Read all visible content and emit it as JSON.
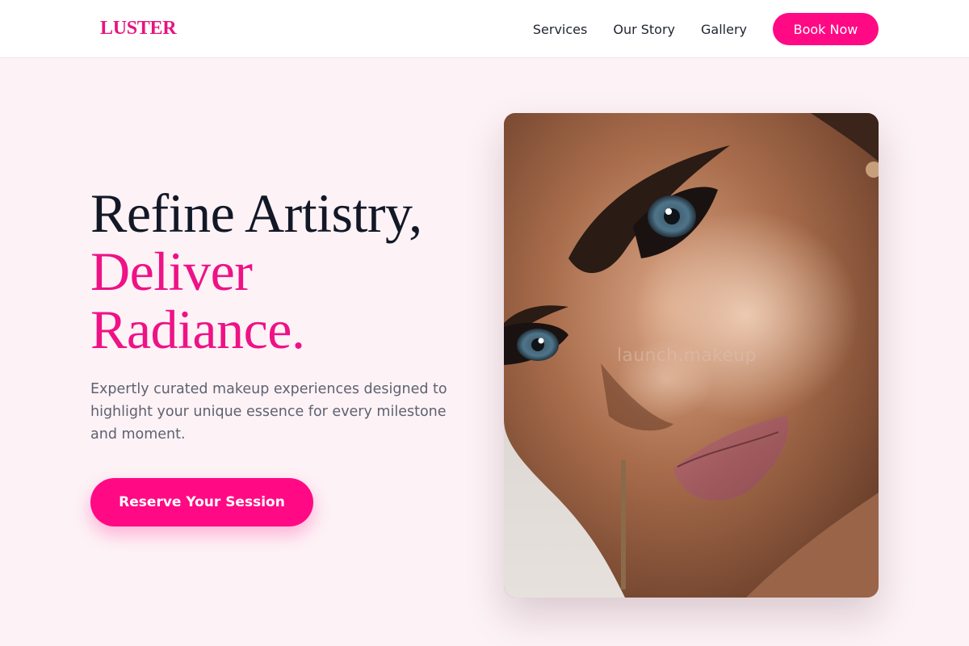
{
  "brand": {
    "logo_text": "LUSTER",
    "accent_color": "#ff0a84"
  },
  "nav": {
    "links": [
      {
        "label": "Services"
      },
      {
        "label": "Our Story"
      },
      {
        "label": "Gallery"
      }
    ],
    "cta_label": "Book Now"
  },
  "hero": {
    "headline_line1": "Refine Artistry,",
    "headline_line2": "Deliver",
    "headline_line3": "Radiance.",
    "description": "Expertly curated makeup experiences designed to highlight your unique essence for every milestone and moment.",
    "cta_label": "Reserve Your Session"
  },
  "photo": {
    "subject": "close-up portrait of a woman with glowing makeup and pink lips",
    "watermark": "launch.makeup"
  }
}
